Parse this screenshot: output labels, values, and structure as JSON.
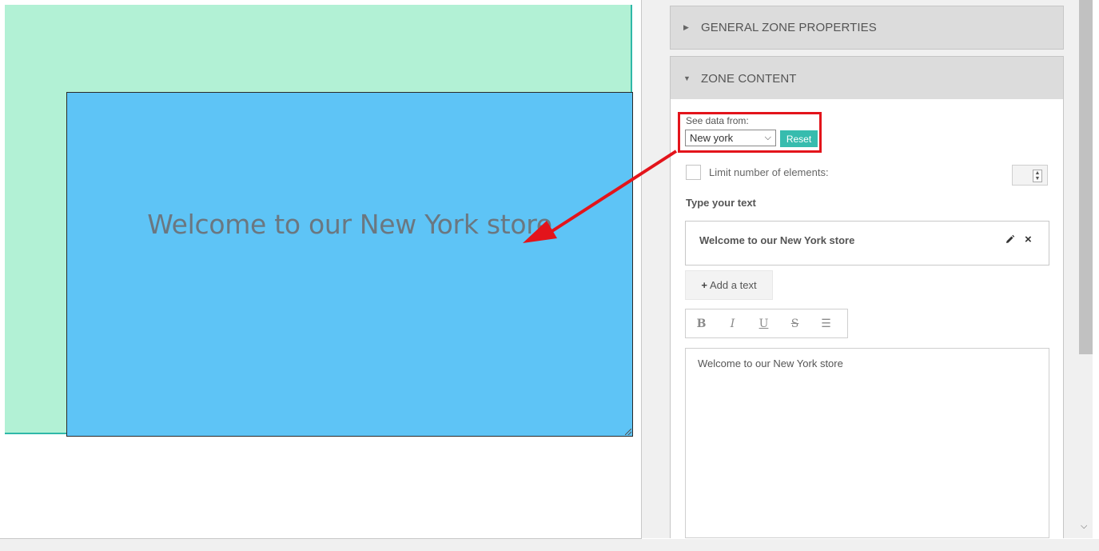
{
  "canvas": {
    "zone_text": "Welcome to our New York store"
  },
  "panel": {
    "general_section": {
      "title": "GENERAL ZONE PROPERTIES",
      "expanded": false
    },
    "content_section": {
      "title": "ZONE CONTENT",
      "expanded": true
    },
    "see_data": {
      "label": "See data from:",
      "selected": "New york",
      "reset_label": "Reset"
    },
    "limit": {
      "label": "Limit number of elements:",
      "checked": false
    },
    "type_text_label": "Type your text",
    "text_entry": {
      "label": "Welcome to our New York store"
    },
    "add_text_label": "Add a text",
    "toolbar": {
      "bold": "B",
      "italic": "I",
      "underline": "U",
      "strike": "S",
      "list": "☰"
    },
    "editor_content": "Welcome to our New York store"
  },
  "colors": {
    "outer_zone": "#b2f1d5",
    "text_zone": "#5ec4f6",
    "accent": "#37bcae",
    "highlight": "#e3141b"
  }
}
